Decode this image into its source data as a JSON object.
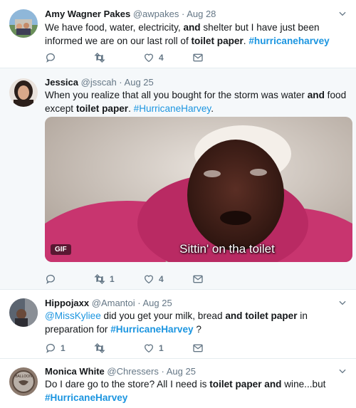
{
  "tweets": [
    {
      "name": "Amy Wagner Pakes",
      "handle": "@awpakes",
      "sep": "·",
      "date": "Aug 28",
      "text": {
        "p1": "We have food, water, electricity, ",
        "b1": "and",
        "p2": " shelter but I have just been informed we are on our last roll of ",
        "b2": "toilet paper",
        "p3": ". ",
        "hash": "#hurricaneharvey"
      },
      "actions": {
        "reply": "",
        "retweet": "",
        "like": "4"
      }
    },
    {
      "name": "Jessica",
      "handle": "@jsscah",
      "sep": "·",
      "date": "Aug 25",
      "text": {
        "p1": "When you realize that all you bought for the storm was water ",
        "b1": "and",
        "p2": " food except ",
        "b2": "toilet paper",
        "p3": ". ",
        "hash": "#HurricaneHarvey",
        "p4": "."
      },
      "media": {
        "badge": "GIF",
        "caption": "Sittin' on tha toilet"
      },
      "actions": {
        "reply": "",
        "retweet": "1",
        "like": "4"
      }
    },
    {
      "name": "Hippojaxx",
      "handle": "@Amantoi",
      "sep": "·",
      "date": "Aug 25",
      "text": {
        "mention": "@MissKyliee",
        "p1": " did you get your milk, bread ",
        "b1": "and toilet paper",
        "p2": " in preparation for ",
        "hash": "#HurricaneHarvey",
        "p3": " ?"
      },
      "actions": {
        "reply": "1",
        "retweet": "",
        "like": "1"
      }
    },
    {
      "name": "Monica White",
      "handle": "@Chressers",
      "sep": "·",
      "date": "Aug 25",
      "avatar_text": "BALLOON",
      "text": {
        "p1": "Do I dare go to the store? All I need is ",
        "b1": "toilet paper and",
        "p2": " wine...but",
        "hash": "#HurricaneHarvey"
      }
    }
  ],
  "colors": {
    "link": "#1b95e0",
    "muted": "#657786",
    "highlight_bg": "#f5f8fa"
  }
}
